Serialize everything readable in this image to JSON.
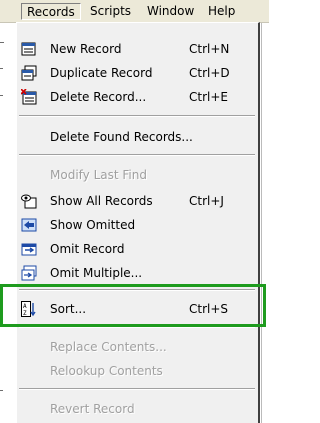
{
  "menubar": {
    "items": [
      {
        "label": "Records",
        "active": true
      },
      {
        "label": "Scripts"
      },
      {
        "label": "Window"
      },
      {
        "label": "Help"
      }
    ]
  },
  "menu": {
    "new_record": {
      "label": "New Record",
      "shortcut": "Ctrl+N",
      "icon": "new-record-icon"
    },
    "duplicate_record": {
      "label": "Duplicate Record",
      "shortcut": "Ctrl+D",
      "icon": "duplicate-record-icon"
    },
    "delete_record": {
      "label": "Delete Record...",
      "shortcut": "Ctrl+E",
      "icon": "delete-record-icon"
    },
    "delete_found_records": {
      "label": "Delete Found Records..."
    },
    "modify_last_find": {
      "label": "Modify Last Find",
      "disabled": true
    },
    "show_all_records": {
      "label": "Show All Records",
      "shortcut": "Ctrl+J",
      "icon": "show-all-records-icon"
    },
    "show_omitted": {
      "label": "Show Omitted",
      "icon": "show-omitted-icon"
    },
    "omit_record": {
      "label": "Omit Record",
      "icon": "omit-record-icon"
    },
    "omit_multiple": {
      "label": "Omit Multiple...",
      "icon": "omit-multiple-icon"
    },
    "sort": {
      "label": "Sort...",
      "shortcut": "Ctrl+S",
      "icon": "sort-icon",
      "highlighted": true
    },
    "replace_contents": {
      "label": "Replace Contents...",
      "disabled": true
    },
    "relookup_contents": {
      "label": "Relookup Contents",
      "disabled": true
    },
    "revert_record": {
      "label": "Revert Record",
      "disabled": true
    }
  },
  "colors": {
    "highlight_box": "#1e9b1e",
    "menu_bg": "#f0f0f0",
    "disabled_text": "#a0a0a0"
  }
}
